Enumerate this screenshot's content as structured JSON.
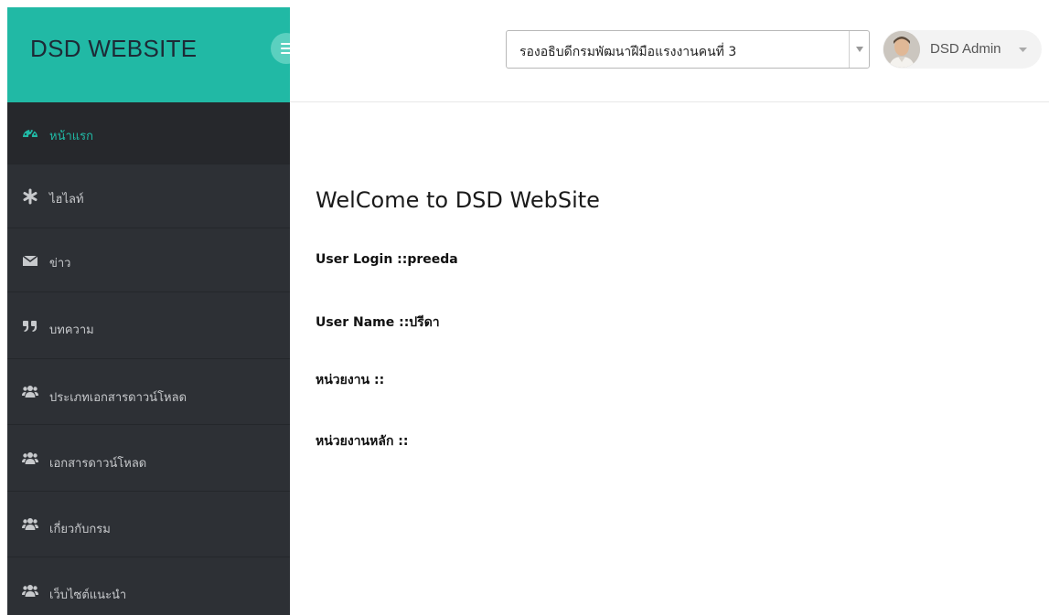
{
  "brand": {
    "title": "DSD WEBSITE"
  },
  "header": {
    "select_value": "รองอธิบดีกรมพัฒนาฝีมือแรงงานคนที่ 3",
    "user_name": "DSD Admin"
  },
  "sidebar": {
    "items": [
      {
        "label": "หน้าแรก",
        "icon": "dashboard-icon",
        "active": true
      },
      {
        "label": "ไฮไลท์",
        "icon": "asterisk-icon",
        "active": false
      },
      {
        "label": "ข่าว",
        "icon": "envelope-icon",
        "active": false
      },
      {
        "label": "บทความ",
        "icon": "quote-icon",
        "active": false
      },
      {
        "label": "ประเภทเอกสารดาวน์โหลด",
        "icon": "users-icon",
        "active": false
      },
      {
        "label": "เอกสารดาวน์โหลด",
        "icon": "users-icon",
        "active": false
      },
      {
        "label": "เกี่ยวกับกรม",
        "icon": "users-icon",
        "active": false
      },
      {
        "label": "เว็บไซต์แนะนำ",
        "icon": "users-icon",
        "active": false
      }
    ]
  },
  "main": {
    "welcome": "WelCome to DSD WebSite",
    "user_login": "User Login ::preeda",
    "user_name": "User Name ::ปรีดา",
    "unit": "หน่วยงาน ::",
    "main_unit": "หน่วยงานหลัก ::"
  },
  "colors": {
    "accent": "#21b9a5",
    "sidebar_bg": "#2d3035",
    "sidebar_active_bg": "#26282c"
  }
}
